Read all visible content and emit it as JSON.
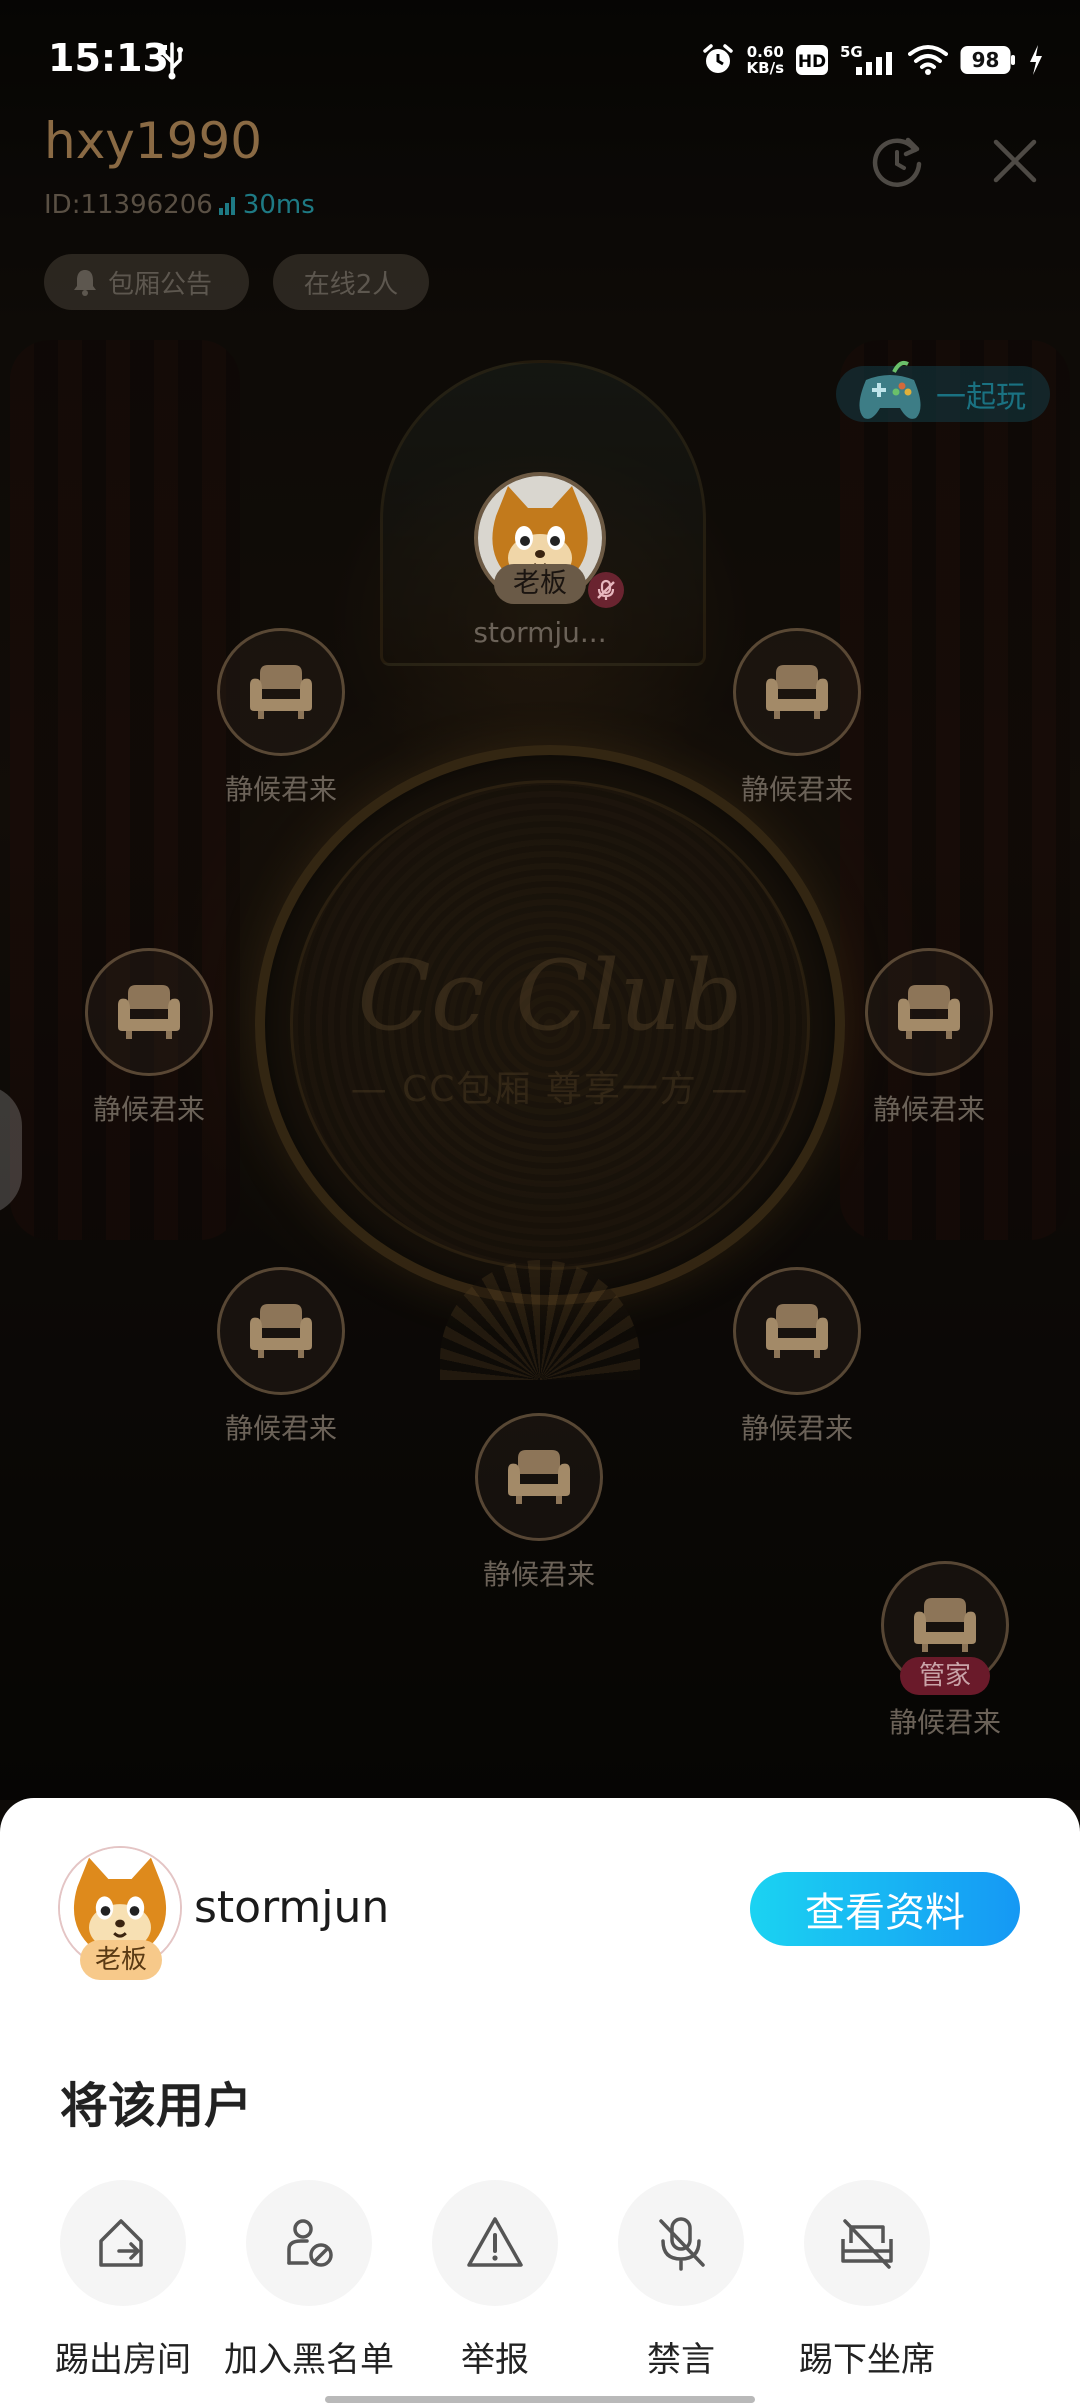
{
  "status_bar": {
    "time": "15:13",
    "net_speed_value": "0.60",
    "net_speed_unit": "KB/s",
    "hd_label": "HD",
    "network_type": "5G",
    "battery": "98"
  },
  "room": {
    "name": "hxy1990",
    "id_text": "ID:11396206",
    "ping": "30ms",
    "notice_label": "包厢公告",
    "online_label": "在线2人",
    "play_together_label": "一起玩",
    "logo_text": "Cc Club",
    "logo_subtitle": "— CC包厢 尊享一方 —"
  },
  "host": {
    "badge": "老板",
    "name": "stormju..."
  },
  "seats": {
    "empty_label": "静候君来",
    "steward_badge": "管家"
  },
  "sheet": {
    "badge": "老板",
    "username": "stormjun",
    "view_profile_label": "查看资料",
    "heading": "将该用户",
    "actions": [
      {
        "label": "踢出房间",
        "icon": "kick-out-icon"
      },
      {
        "label": "加入黑名单",
        "icon": "blacklist-icon"
      },
      {
        "label": "举报",
        "icon": "report-icon"
      },
      {
        "label": "禁言",
        "icon": "mute-icon"
      },
      {
        "label": "踢下坐席",
        "icon": "remove-seat-icon"
      }
    ]
  },
  "colors": {
    "accent_blue": "#1598f4",
    "accent_cyan": "#1bd3f2",
    "room_name": "#8a6a44",
    "sheet_bg": "#ffffff"
  }
}
